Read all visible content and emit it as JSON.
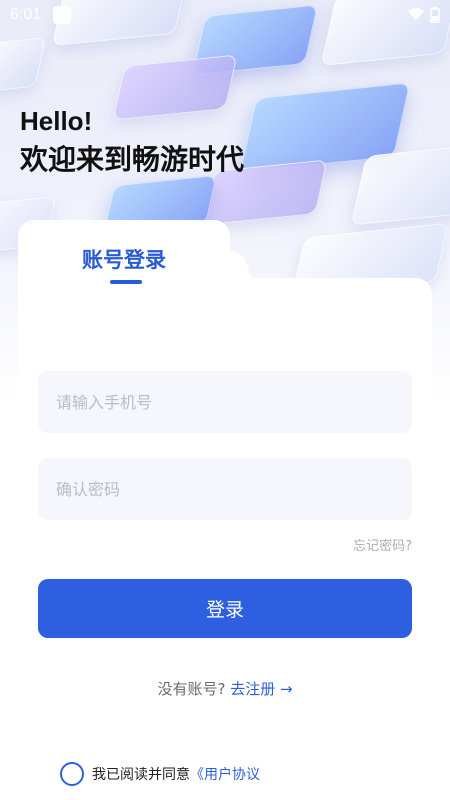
{
  "status_bar": {
    "time": "6:01",
    "icons": [
      "app-icon",
      "wifi-icon",
      "battery-icon"
    ]
  },
  "greeting": {
    "hello": "Hello!",
    "welcome": "欢迎来到畅游时代"
  },
  "tabs": {
    "active_label": "账号登录"
  },
  "form": {
    "phone_placeholder": "请输入手机号",
    "phone_value": "",
    "password_placeholder": "确认密码",
    "password_value": "",
    "forgot_label": "忘记密码?",
    "login_label": "登录"
  },
  "register": {
    "prompt": "没有账号?",
    "link": "去注册 →"
  },
  "agreement": {
    "prefix": "我已阅读并同意",
    "link": "《用户协议",
    "checked": false
  },
  "colors": {
    "accent": "#2e5fe0",
    "tab_accent": "#2a5bd7",
    "input_bg": "#f5f7fc",
    "placeholder": "#b7bcc6"
  }
}
